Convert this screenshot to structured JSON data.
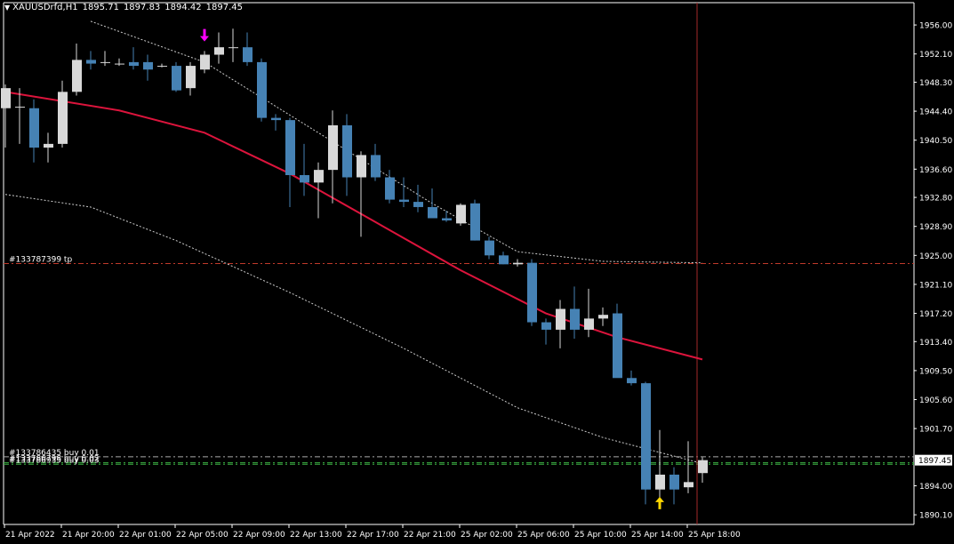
{
  "header": {
    "symbol": "XAUUSDrfd,H1",
    "open": "1895.71",
    "high": "1897.83",
    "low": "1894.42",
    "close": "1897.45"
  },
  "chart_data": {
    "type": "candlestick",
    "symbol": "XAUUSDrfd",
    "timeframe": "H1",
    "ylim": [
      1888.8,
      1959.0
    ],
    "y_ticks": [
      "1956.00",
      "1952.10",
      "1948.30",
      "1944.40",
      "1940.50",
      "1936.60",
      "1932.80",
      "1928.90",
      "1925.00",
      "1921.10",
      "1917.20",
      "1913.40",
      "1909.50",
      "1905.60",
      "1901.70",
      "1897.45",
      "1894.00",
      "1890.10"
    ],
    "x_ticks": [
      "21 Apr 2022",
      "21 Apr 20:00",
      "22 Apr 01:00",
      "22 Apr 05:00",
      "22 Apr 09:00",
      "22 Apr 13:00",
      "22 Apr 17:00",
      "22 Apr 21:00",
      "25 Apr 02:00",
      "25 Apr 06:00",
      "25 Apr 10:00",
      "25 Apr 14:00",
      "25 Apr 18:00"
    ],
    "candles": [
      {
        "o": 1944.8,
        "h": 1948.0,
        "l": 1939.5,
        "c": 1947.5
      },
      {
        "o": 1945.0,
        "h": 1947.5,
        "l": 1940.0,
        "c": 1945.0
      },
      {
        "o": 1944.8,
        "h": 1946.0,
        "l": 1937.5,
        "c": 1939.5
      },
      {
        "o": 1939.5,
        "h": 1941.5,
        "l": 1937.5,
        "c": 1940.0
      },
      {
        "o": 1940.0,
        "h": 1948.5,
        "l": 1939.5,
        "c": 1947.0
      },
      {
        "o": 1947.0,
        "h": 1953.5,
        "l": 1946.5,
        "c": 1951.3
      },
      {
        "o": 1951.3,
        "h": 1952.5,
        "l": 1950.0,
        "c": 1950.8
      },
      {
        "o": 1951.0,
        "h": 1952.5,
        "l": 1950.5,
        "c": 1951.0
      },
      {
        "o": 1950.8,
        "h": 1951.5,
        "l": 1950.5,
        "c": 1950.8
      },
      {
        "o": 1951.0,
        "h": 1953.0,
        "l": 1950.0,
        "c": 1950.5
      },
      {
        "o": 1951.0,
        "h": 1952.0,
        "l": 1948.5,
        "c": 1950.0
      },
      {
        "o": 1950.5,
        "h": 1950.8,
        "l": 1950.3,
        "c": 1950.5
      },
      {
        "o": 1950.5,
        "h": 1951.0,
        "l": 1947.0,
        "c": 1947.2
      },
      {
        "o": 1947.5,
        "h": 1951.0,
        "l": 1946.5,
        "c": 1950.5
      },
      {
        "o": 1950.0,
        "h": 1952.5,
        "l": 1949.5,
        "c": 1952.0
      },
      {
        "o": 1952.0,
        "h": 1955.0,
        "l": 1950.8,
        "c": 1953.0
      },
      {
        "o": 1953.0,
        "h": 1955.5,
        "l": 1951.0,
        "c": 1953.0
      },
      {
        "o": 1953.0,
        "h": 1955.0,
        "l": 1950.5,
        "c": 1951.0
      },
      {
        "o": 1951.0,
        "h": 1951.5,
        "l": 1943.0,
        "c": 1943.5
      },
      {
        "o": 1943.5,
        "h": 1944.0,
        "l": 1941.8,
        "c": 1943.2
      },
      {
        "o": 1943.2,
        "h": 1943.5,
        "l": 1931.5,
        "c": 1935.8
      },
      {
        "o": 1935.8,
        "h": 1940.0,
        "l": 1933.0,
        "c": 1934.8
      },
      {
        "o": 1934.8,
        "h": 1937.5,
        "l": 1930.0,
        "c": 1936.5
      },
      {
        "o": 1936.5,
        "h": 1944.5,
        "l": 1932.0,
        "c": 1942.5
      },
      {
        "o": 1942.5,
        "h": 1944.0,
        "l": 1933.0,
        "c": 1935.5
      },
      {
        "o": 1935.5,
        "h": 1939.0,
        "l": 1927.5,
        "c": 1938.5
      },
      {
        "o": 1938.5,
        "h": 1940.0,
        "l": 1935.0,
        "c": 1935.5
      },
      {
        "o": 1935.5,
        "h": 1936.5,
        "l": 1932.0,
        "c": 1932.5
      },
      {
        "o": 1932.5,
        "h": 1935.5,
        "l": 1931.5,
        "c": 1932.2
      },
      {
        "o": 1932.2,
        "h": 1934.5,
        "l": 1930.8,
        "c": 1931.5
      },
      {
        "o": 1931.5,
        "h": 1934.0,
        "l": 1930.0,
        "c": 1930.0
      },
      {
        "o": 1930.0,
        "h": 1931.0,
        "l": 1929.5,
        "c": 1929.7
      },
      {
        "o": 1929.3,
        "h": 1932.0,
        "l": 1929.0,
        "c": 1931.8
      },
      {
        "o": 1932.0,
        "h": 1932.5,
        "l": 1927.0,
        "c": 1927.0
      },
      {
        "o": 1927.0,
        "h": 1927.5,
        "l": 1924.5,
        "c": 1925.0
      },
      {
        "o": 1925.0,
        "h": 1925.5,
        "l": 1923.8,
        "c": 1923.8
      },
      {
        "o": 1923.8,
        "h": 1924.5,
        "l": 1923.5,
        "c": 1924.0
      },
      {
        "o": 1924.0,
        "h": 1924.5,
        "l": 1915.5,
        "c": 1916.0
      },
      {
        "o": 1916.0,
        "h": 1916.5,
        "l": 1913.0,
        "c": 1915.0
      },
      {
        "o": 1915.0,
        "h": 1919.0,
        "l": 1912.5,
        "c": 1917.8
      },
      {
        "o": 1917.8,
        "h": 1920.8,
        "l": 1913.8,
        "c": 1915.0
      },
      {
        "o": 1915.0,
        "h": 1920.5,
        "l": 1914.0,
        "c": 1916.5
      },
      {
        "o": 1916.5,
        "h": 1918.0,
        "l": 1915.5,
        "c": 1917.0
      },
      {
        "o": 1917.2,
        "h": 1918.5,
        "l": 1909.0,
        "c": 1908.5
      },
      {
        "o": 1908.5,
        "h": 1909.5,
        "l": 1907.5,
        "c": 1907.8
      },
      {
        "o": 1907.8,
        "h": 1908.0,
        "l": 1891.5,
        "c": 1893.5
      },
      {
        "o": 1893.5,
        "h": 1901.5,
        "l": 1891.8,
        "c": 1895.5
      },
      {
        "o": 1895.5,
        "h": 1896.5,
        "l": 1891.5,
        "c": 1893.5
      },
      {
        "o": 1893.8,
        "h": 1900.0,
        "l": 1893.0,
        "c": 1894.5
      },
      {
        "o": 1895.71,
        "h": 1897.83,
        "l": 1894.42,
        "c": 1897.45
      }
    ],
    "ma": [
      {
        "i": 0,
        "v": 1947.0
      },
      {
        "i": 8,
        "v": 1944.5
      },
      {
        "i": 14,
        "v": 1941.5
      },
      {
        "i": 20,
        "v": 1936.0
      },
      {
        "i": 26,
        "v": 1929.5
      },
      {
        "i": 32,
        "v": 1923.0
      },
      {
        "i": 38,
        "v": 1917.2
      },
      {
        "i": 43,
        "v": 1914.0
      },
      {
        "i": 49,
        "v": 1911.0
      }
    ],
    "envelope_upper": [
      {
        "i": 6,
        "v": 1956.5
      },
      {
        "i": 14,
        "v": 1951.0
      },
      {
        "i": 22,
        "v": 1941.5
      },
      {
        "i": 30,
        "v": 1932.0
      },
      {
        "i": 36,
        "v": 1925.5
      },
      {
        "i": 42,
        "v": 1924.2
      },
      {
        "i": 49,
        "v": 1924.0
      }
    ],
    "envelope_lower": [
      {
        "i": 0,
        "v": 1933.2
      },
      {
        "i": 6,
        "v": 1931.5
      },
      {
        "i": 12,
        "v": 1927.0
      },
      {
        "i": 20,
        "v": 1920.0
      },
      {
        "i": 28,
        "v": 1912.5
      },
      {
        "i": 36,
        "v": 1904.5
      },
      {
        "i": 42,
        "v": 1900.5
      },
      {
        "i": 49,
        "v": 1897.0
      }
    ],
    "lines": [
      {
        "label": "#133787399 tp",
        "price": 1923.9,
        "color": "#c0392b"
      },
      {
        "label": "#133786435 buy 0.01",
        "price": 1897.9,
        "color": "#aaaaaa"
      },
      {
        "label": "#133786798 buy 0.02",
        "price": 1897.1,
        "color": "#3cb043"
      },
      {
        "label": "#133786935 buy 0.03",
        "price": 1896.9,
        "color": "#3cb043"
      }
    ],
    "current_price": "1897.45",
    "signals": [
      {
        "type": "sell",
        "index": 14,
        "price": 1954.5,
        "color": "#ff00ff"
      },
      {
        "type": "buy",
        "index": 46,
        "price": 1891.8,
        "color": "#ffd700"
      }
    ],
    "vline_index": 49,
    "colors": {
      "bull": "#d8d8d8",
      "bear": "#4682b4",
      "ma": "#dc143c",
      "grid": "#ffffff",
      "vline": "#a52a2a",
      "background": "#000000"
    }
  }
}
